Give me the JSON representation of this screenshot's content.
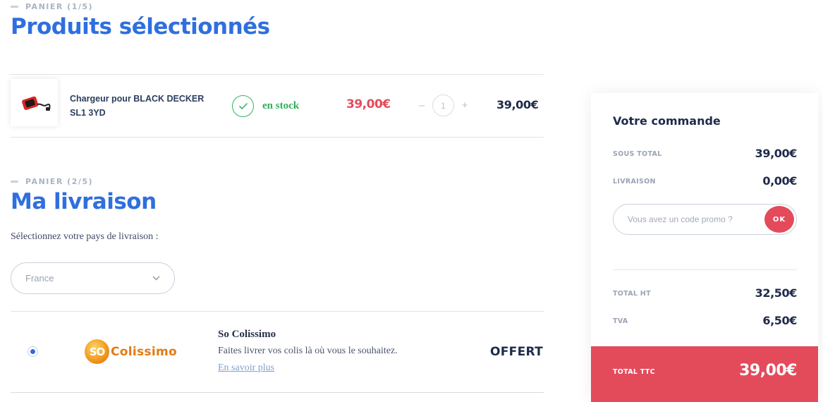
{
  "cart": {
    "step_label": "PANIER (1/5)",
    "title": "Produits sélectionnés",
    "item": {
      "name": "Chargeur pour BLACK DECKER SL1 3YD",
      "image_icon": "charger-icon",
      "stock_status": "en stock",
      "stock_icon": "check-icon",
      "unit_price": "39,00€",
      "quantity": "1",
      "decrease_label": "–",
      "increase_label": "+",
      "line_total": "39,00€"
    }
  },
  "delivery": {
    "step_label": "PANIER (2/5)",
    "title": "Ma livraison",
    "country_prompt": "Sélectionnez votre pays de livraison :",
    "country_selected": "France",
    "option": {
      "logo_badge": "SO",
      "logo_word": "Colissimo",
      "name": "So Colissimo",
      "description": "Faites livrer vos colis là où vous le souhaitez.",
      "more_link": "En savoir plus",
      "price": "OFFERT",
      "selected": true
    }
  },
  "summary": {
    "title": "Votre commande",
    "subtotal_label": "SOUS TOTAL",
    "subtotal_value": "39,00€",
    "shipping_label": "LIVRAISON",
    "shipping_value": "0,00€",
    "promo_placeholder": "Vous avez un code promo ?",
    "promo_button": "OK",
    "total_ht_label": "TOTAL HT",
    "total_ht_value": "32,50€",
    "tva_label": "TVA",
    "tva_value": "6,50€",
    "total_ttc_label": "TOTAL TTC",
    "total_ttc_value": "39,00€"
  },
  "colors": {
    "accent_blue": "#2f6fdf",
    "price_red": "#e34b5b",
    "stock_green": "#2fae5c",
    "colissimo_orange": "#e37a12"
  }
}
